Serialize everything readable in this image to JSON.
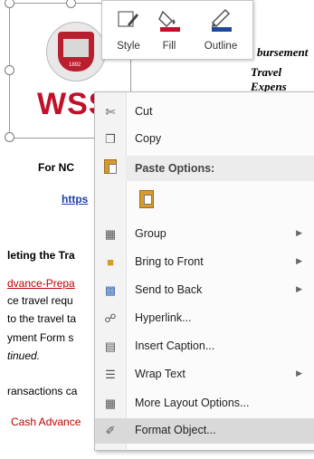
{
  "document": {
    "title_1": "bursement",
    "title_2": "Travel Expens",
    "logo_text": "WSSU",
    "logo_year": "1892",
    "for_line": "For NC",
    "link_fragment": "https",
    "heading": "leting the Tra",
    "lines": [
      {
        "text": "dvance-Prepa",
        "red": true
      },
      {
        "text": "ce travel requ",
        "red": false
      },
      {
        "text": "to the travel ta",
        "red": false
      },
      {
        "text": "yment Form s",
        "red": false
      },
      {
        "text": "tinued.",
        "red": false
      },
      {
        "text": "ransactions ca",
        "red": false
      },
      {
        "text": "Cash Advance",
        "red": true
      }
    ]
  },
  "mini_toolbar": {
    "style_label": "Style",
    "fill_label": "Fill",
    "outline_label": "Outline",
    "fill_color": "#c0102a",
    "outline_color": "#1f4a9c"
  },
  "context_menu": {
    "cut": "Cut",
    "copy": "Copy",
    "paste_options": "Paste Options:",
    "group": "Group",
    "bring_to_front": "Bring to Front",
    "send_to_back": "Send to Back",
    "hyperlink": "Hyperlink...",
    "insert_caption": "Insert Caption...",
    "wrap_text": "Wrap Text",
    "more_layout": "More Layout Options...",
    "format_object": "Format Object..."
  }
}
